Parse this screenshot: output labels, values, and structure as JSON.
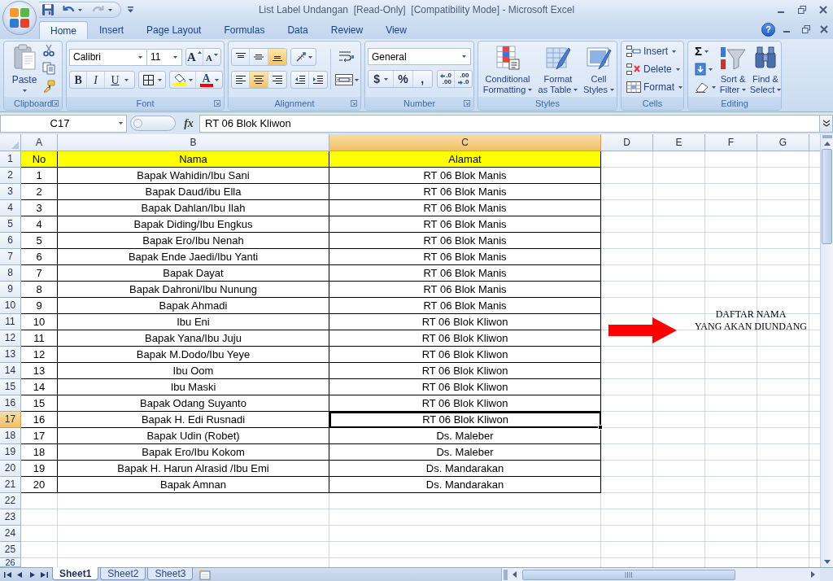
{
  "window": {
    "title": "List Label Undangan  [Read-Only]  [Compatibility Mode] - Microsoft Excel",
    "help": "?"
  },
  "tabs": [
    {
      "label": "Home",
      "selected": true
    },
    {
      "label": "Insert",
      "selected": false
    },
    {
      "label": "Page Layout",
      "selected": false
    },
    {
      "label": "Formulas",
      "selected": false
    },
    {
      "label": "Data",
      "selected": false
    },
    {
      "label": "Review",
      "selected": false
    },
    {
      "label": "View",
      "selected": false
    }
  ],
  "ribbon": {
    "clipboard": {
      "label": "Clipboard",
      "launcher": true,
      "paste": "Paste"
    },
    "font": {
      "label": "Font",
      "launcher": true,
      "font_name": "Calibri",
      "font_size": "11",
      "grow": "A",
      "shrink": "A",
      "styles": [
        "B",
        "I",
        "U"
      ],
      "font_color": "A"
    },
    "alignment": {
      "label": "Alignment",
      "launcher": true,
      "vertical": [
        {
          "selected": false
        },
        {
          "selected": false
        },
        {
          "selected": true
        }
      ],
      "horizontal": [
        {
          "selected": false
        },
        {
          "selected": true
        },
        {
          "selected": false
        }
      ]
    },
    "number": {
      "label": "Number",
      "launcher": true,
      "format": "General",
      "symbols": [
        "$",
        "%",
        ","
      ],
      "decimals": [
        {
          "top": ".0",
          "bottom": ".00"
        },
        {
          "top": ".00",
          "bottom": ".0"
        }
      ]
    },
    "styles": {
      "label": "Styles",
      "launcher": false,
      "buttons": [
        {
          "lines": [
            "Conditional",
            "Formatting"
          ]
        },
        {
          "lines": [
            "Format",
            "as Table"
          ]
        },
        {
          "lines": [
            "Cell",
            "Styles"
          ]
        }
      ]
    },
    "cells": {
      "label": "Cells",
      "launcher": false,
      "buttons": [
        "Insert",
        "Delete",
        "Format"
      ]
    },
    "editing": {
      "label": "Editing",
      "launcher": false,
      "sum": "Σ",
      "buttons": [
        {
          "lines": [
            "Sort &",
            "Filter"
          ]
        },
        {
          "lines": [
            "Find &",
            "Select"
          ]
        }
      ]
    }
  },
  "formula_bar": {
    "name_box": "C17",
    "fx": "fx",
    "formula": "RT 06 Blok Kliwon"
  },
  "sheet": {
    "columns": [
      {
        "label": "A",
        "selected": false
      },
      {
        "label": "B",
        "selected": false
      },
      {
        "label": "C",
        "selected": true
      },
      {
        "label": "D",
        "selected": false
      },
      {
        "label": "E",
        "selected": false
      },
      {
        "label": "F",
        "selected": false
      },
      {
        "label": "G",
        "selected": false
      }
    ],
    "rows": [
      {
        "label": "1",
        "selected": false,
        "kind": "header",
        "cells": [
          "No",
          "Nama",
          "Alamat"
        ]
      },
      {
        "label": "2",
        "selected": false,
        "kind": "data",
        "cells": [
          "1",
          "Bapak Wahidin/Ibu Sani",
          "RT 06 Blok Manis"
        ]
      },
      {
        "label": "3",
        "selected": false,
        "kind": "data",
        "cells": [
          "2",
          "Bapak Daud/ibu Ella",
          "RT 06 Blok Manis"
        ]
      },
      {
        "label": "4",
        "selected": false,
        "kind": "data",
        "cells": [
          "3",
          "Bapak Dahlan/Ibu Ilah",
          "RT 06 Blok Manis"
        ]
      },
      {
        "label": "5",
        "selected": false,
        "kind": "data",
        "cells": [
          "4",
          "Bapak Diding/Ibu Engkus",
          "RT 06 Blok Manis"
        ]
      },
      {
        "label": "6",
        "selected": false,
        "kind": "data",
        "cells": [
          "5",
          "Bapak Ero/Ibu Nenah",
          "RT 06 Blok Manis"
        ]
      },
      {
        "label": "7",
        "selected": false,
        "kind": "data",
        "cells": [
          "6",
          "Bapak Ende Jaedi/Ibu Yanti",
          "RT 06 Blok Manis"
        ]
      },
      {
        "label": "8",
        "selected": false,
        "kind": "data",
        "cells": [
          "7",
          "Bapak Dayat",
          "RT 06 Blok Manis"
        ]
      },
      {
        "label": "9",
        "selected": false,
        "kind": "data",
        "cells": [
          "8",
          "Bapak Dahroni/Ibu Nunung",
          "RT 06 Blok Manis"
        ]
      },
      {
        "label": "10",
        "selected": false,
        "kind": "data",
        "cells": [
          "9",
          "Bapak Ahmadi",
          "RT 06 Blok Manis"
        ]
      },
      {
        "label": "11",
        "selected": false,
        "kind": "data",
        "cells": [
          "10",
          "Ibu Eni",
          "RT 06 Blok Kliwon"
        ]
      },
      {
        "label": "12",
        "selected": false,
        "kind": "data",
        "cells": [
          "11",
          "Bapak Yana/Ibu Juju",
          "RT 06 Blok Kliwon"
        ]
      },
      {
        "label": "13",
        "selected": false,
        "kind": "data",
        "cells": [
          "12",
          "Bapak M.Dodo/Ibu Yeye",
          "RT 06 Blok Kliwon"
        ]
      },
      {
        "label": "14",
        "selected": false,
        "kind": "data",
        "cells": [
          "13",
          "Ibu Oom",
          "RT 06 Blok Kliwon"
        ]
      },
      {
        "label": "15",
        "selected": false,
        "kind": "data",
        "cells": [
          "14",
          "Ibu Maski",
          "RT 06 Blok Kliwon"
        ]
      },
      {
        "label": "16",
        "selected": false,
        "kind": "data",
        "cells": [
          "15",
          "Bapak Odang Suyanto",
          "RT 06 Blok Kliwon"
        ]
      },
      {
        "label": "17",
        "selected": true,
        "kind": "data",
        "cells": [
          "16",
          "Bapak H. Edi Rusnadi",
          "RT 06 Blok Kliwon"
        ]
      },
      {
        "label": "18",
        "selected": false,
        "kind": "data",
        "cells": [
          "17",
          "Bapak Udin (Robet)",
          "Ds. Maleber"
        ]
      },
      {
        "label": "19",
        "selected": false,
        "kind": "data",
        "cells": [
          "18",
          "Bapak Ero/Ibu Kokom",
          "Ds. Maleber"
        ]
      },
      {
        "label": "20",
        "selected": false,
        "kind": "data",
        "cells": [
          "19",
          "Bapak H. Harun Alrasid /Ibu Emi",
          "Ds. Mandarakan"
        ]
      },
      {
        "label": "21",
        "selected": false,
        "kind": "data",
        "cells": [
          "20",
          "Bapak Amnan",
          "Ds. Mandarakan"
        ]
      },
      {
        "label": "22",
        "selected": false,
        "kind": "empty"
      },
      {
        "label": "23",
        "selected": false,
        "kind": "empty"
      },
      {
        "label": "24",
        "selected": false,
        "kind": "empty"
      },
      {
        "label": "25",
        "selected": false,
        "kind": "empty"
      },
      {
        "label": "26",
        "selected": false,
        "kind": "empty"
      }
    ]
  },
  "note": {
    "lines": [
      "DAFTAR NAMA",
      "YANG AKAN DIUNDANG"
    ]
  },
  "sheet_tabs": [
    {
      "label": "Sheet1",
      "selected": true
    },
    {
      "label": "Sheet2",
      "selected": false
    },
    {
      "label": "Sheet3",
      "selected": false
    }
  ]
}
